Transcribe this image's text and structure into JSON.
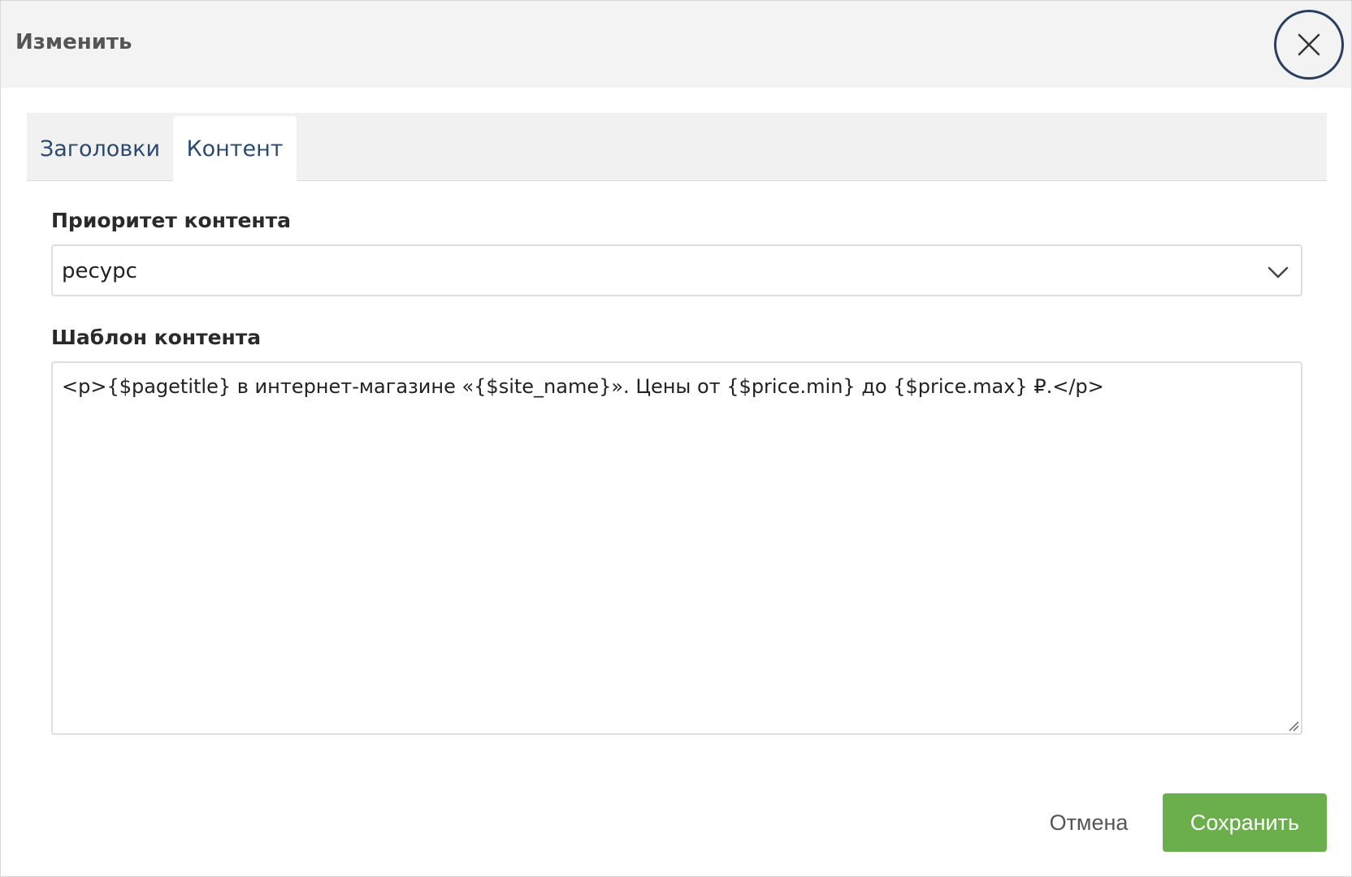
{
  "dialog": {
    "title": "Изменить",
    "close_icon": "close-icon"
  },
  "tabs": [
    {
      "label": "Заголовки",
      "active": false
    },
    {
      "label": "Контент",
      "active": true
    }
  ],
  "form": {
    "priority": {
      "label": "Приоритет контента",
      "value": "ресурс",
      "icon": "chevron-down-icon"
    },
    "template": {
      "label": "Шаблон контента",
      "value": "<p>{$pagetitle} в интернет-магазине «{$site_name}». Цены от {$price.min} до {$price.max} ₽.</p>"
    }
  },
  "footer": {
    "cancel_label": "Отмена",
    "save_label": "Сохранить"
  },
  "colors": {
    "accent_green": "#6aaf4c",
    "tab_text": "#2c4a70",
    "close_ring": "#2a3f5f",
    "header_bg": "#f3f3f3"
  }
}
